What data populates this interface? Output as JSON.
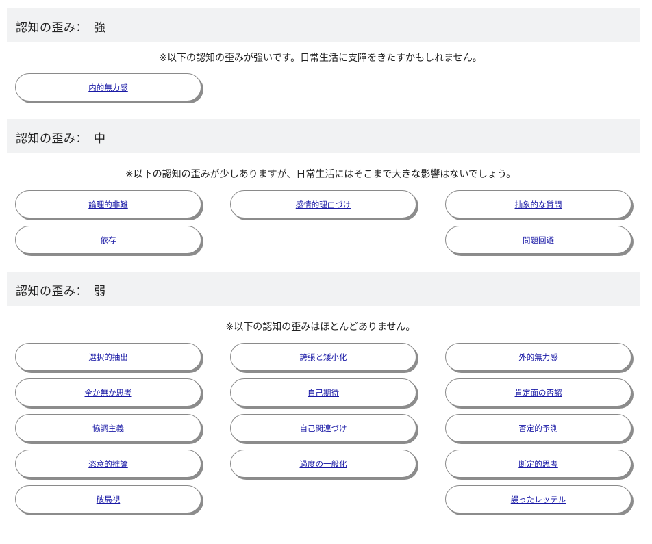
{
  "sections": [
    {
      "title": "認知の歪み：　強",
      "notice": "※以下の認知の歪みが強いです。日常生活に支障をきたすかもしれません。",
      "items": [
        "内的無力感"
      ]
    },
    {
      "title": "認知の歪み：　中",
      "notice": "※以下の認知の歪みが少しありますが、日常生活にはそこまで大きな影響はないでしょう。",
      "items": [
        "論理的非難",
        "感情的理由づけ",
        "抽象的な質問",
        "依存",
        "問題回避"
      ]
    },
    {
      "title": "認知の歪み：　弱",
      "notice": "※以下の認知の歪みはほとんどありません。",
      "items": [
        "選択的抽出",
        "誇張と矮小化",
        "外的無力感",
        "全か無か思考",
        "自己期待",
        "肯定面の否認",
        "協調主義",
        "自己関連づけ",
        "否定的予測",
        "恣意的推論",
        "過度の一般化",
        "断定的思考",
        "破局視",
        "誤ったレッテル"
      ]
    }
  ],
  "colors": {
    "header_bg": "#f1f2f3",
    "link": "#1a1aa6",
    "pill_shadow": "#8c8c8c"
  }
}
